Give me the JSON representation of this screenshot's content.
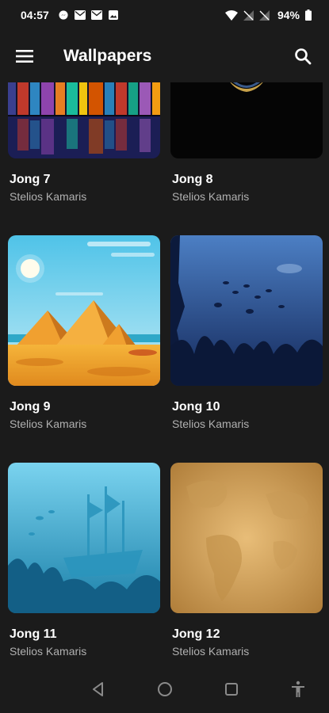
{
  "status_bar": {
    "time": "04:57",
    "battery": "94%",
    "left_icons": [
      "messenger-icon",
      "mail-icon",
      "mail-icon",
      "gallery-icon"
    ],
    "right_icons": [
      "wifi-icon",
      "no-signal-icon",
      "no-signal-icon",
      "battery-icon"
    ]
  },
  "app_bar": {
    "title": "Wallpapers",
    "menu_icon": "hamburger-menu-icon",
    "search_icon": "search-icon"
  },
  "wallpapers": [
    {
      "title": "Jong 7",
      "author": "Stelios Kamaris",
      "theme": "pixel-city-night"
    },
    {
      "title": "Jong 8",
      "author": "Stelios Kamaris",
      "theme": "dark-emblem"
    },
    {
      "title": "Jong 9",
      "author": "Stelios Kamaris",
      "theme": "desert-pyramids"
    },
    {
      "title": "Jong 10",
      "author": "Stelios Kamaris",
      "theme": "deep-sea-reef"
    },
    {
      "title": "Jong 11",
      "author": "Stelios Kamaris",
      "theme": "sunken-ship"
    },
    {
      "title": "Jong 12",
      "author": "Stelios Kamaris",
      "theme": "old-world-map"
    }
  ],
  "nav_bar": {
    "icons": [
      "back-icon",
      "home-icon",
      "recents-icon",
      "accessibility-icon"
    ]
  }
}
